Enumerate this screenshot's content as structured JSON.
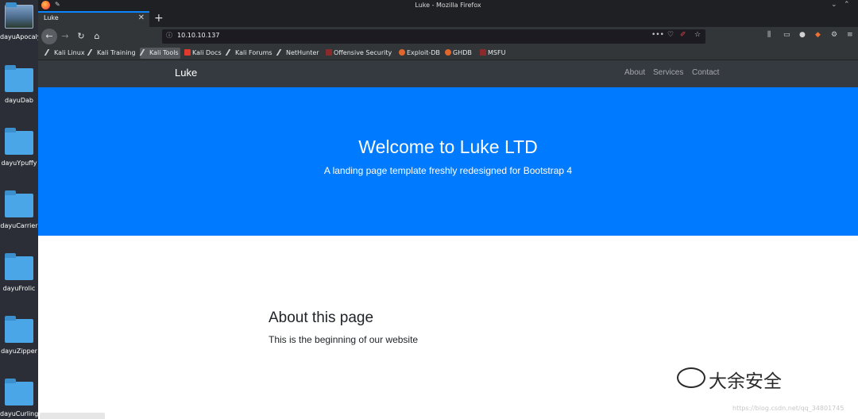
{
  "window": {
    "title": "Luke - Mozilla Firefox"
  },
  "desktop": {
    "icons": [
      {
        "label": "dayuApocalyst",
        "kind": "image"
      },
      {
        "label": "dayuDab"
      },
      {
        "label": "dayuYpuffy"
      },
      {
        "label": "dayuCarrier"
      },
      {
        "label": "dayuFrolic"
      },
      {
        "label": "dayuZipper"
      },
      {
        "label": "dayuCurling"
      }
    ]
  },
  "tabs": [
    {
      "title": "Luke"
    }
  ],
  "toolbar": {
    "url": "10.10.10.137",
    "page_actions": "•••"
  },
  "bookmarks": [
    {
      "label": "Kali Linux"
    },
    {
      "label": "Kali Training"
    },
    {
      "label": "Kali Tools"
    },
    {
      "label": "Kali Docs"
    },
    {
      "label": "Kali Forums"
    },
    {
      "label": "NetHunter"
    },
    {
      "label": "Offensive Security"
    },
    {
      "label": "Exploit-DB"
    },
    {
      "label": "GHDB"
    },
    {
      "label": "MSFU"
    }
  ],
  "site": {
    "brand": "Luke",
    "nav": [
      "About",
      "Services",
      "Contact"
    ],
    "hero": {
      "title": "Welcome to Luke LTD",
      "subtitle": "A landing page template freshly redesigned for Bootstrap 4"
    },
    "about": {
      "title": "About this page",
      "text": "This is the beginning of our website"
    }
  },
  "overlay": {
    "watermark": "大余安全",
    "source_url": "https://blog.csdn.net/qq_34801745"
  },
  "colors": {
    "hero_blue": "#007bff",
    "site_nav": "#343a40",
    "firefox_chrome": "#323639"
  }
}
